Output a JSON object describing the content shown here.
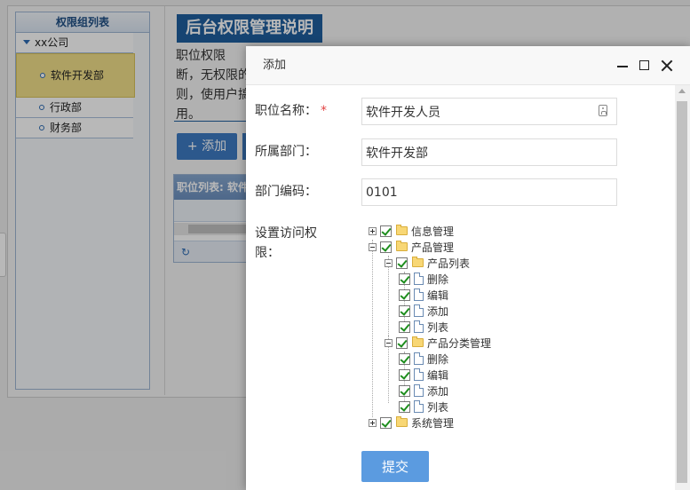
{
  "background": {
    "sidebar": {
      "title": "权限组列表",
      "root": "xx公司",
      "departments": [
        "软件开发部",
        "行政部",
        "财务部"
      ]
    },
    "main": {
      "title": "后台权限管理说明",
      "description": "职位权限\n断，无权限的\n则，使用户搞\n用。",
      "add_button": "+ 添加",
      "grid_title": "职位列表: 软件"
    }
  },
  "dialog": {
    "title": "添加",
    "fields": {
      "position_name": {
        "label": "职位名称：",
        "required_mark": "*",
        "value": "软件开发人员"
      },
      "department": {
        "label": "所属部门：",
        "value": "软件开发部"
      },
      "dept_code": {
        "label": "部门编码：",
        "value": "0101"
      }
    },
    "permissions_label": "设置访问权限：",
    "tree": {
      "info": "信息管理",
      "product": "产品管理",
      "product_list": "产品列表",
      "product_list_items": [
        "删除",
        "编辑",
        "添加",
        "列表"
      ],
      "product_category": "产品分类管理",
      "product_category_items": [
        "删除",
        "编辑",
        "添加",
        "列表"
      ],
      "system": "系统管理"
    },
    "submit": "提交"
  },
  "colors": {
    "accent": "#5b9be0",
    "title_bg": "#1f5f9f",
    "check": "#1e8e1e"
  },
  "icons": [
    "contact-icon",
    "minimize-icon",
    "maximize-icon",
    "close-icon",
    "folder-icon",
    "file-icon",
    "checkbox",
    "expander"
  ]
}
